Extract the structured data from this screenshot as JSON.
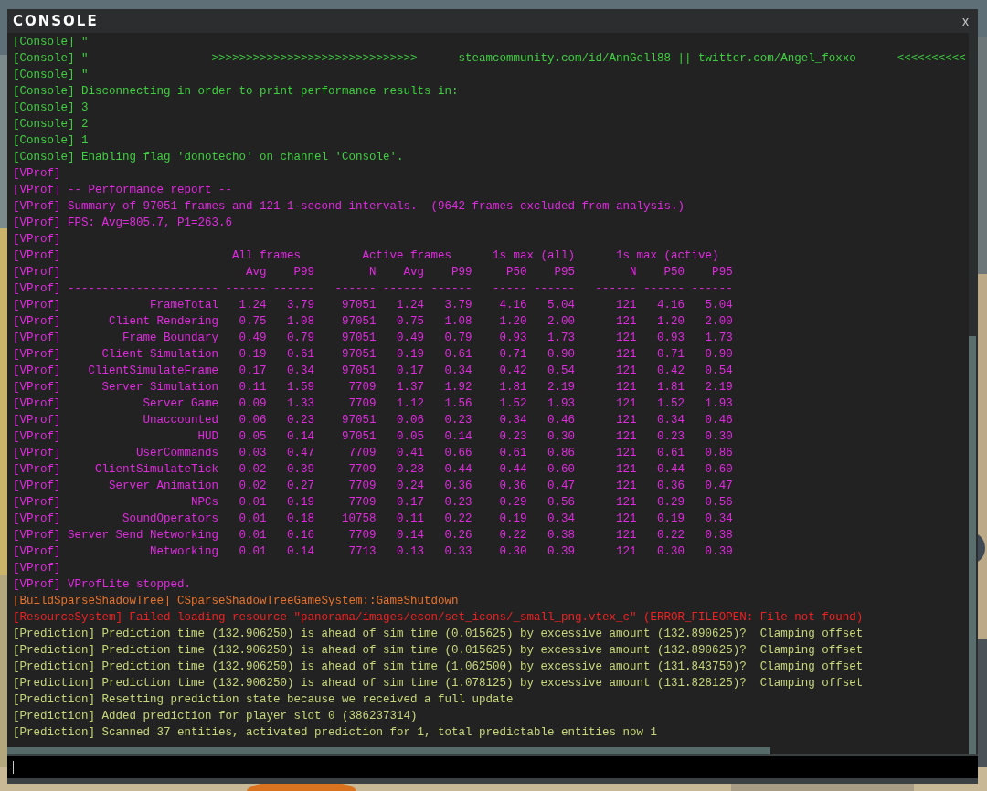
{
  "window": {
    "title": "CONSOLE",
    "close": "x"
  },
  "lines": [
    {
      "kind": "console",
      "text": "[Console] \""
    },
    {
      "kind": "console",
      "text": "[Console] \"                  >>>>>>>>>>>>>>>>>>>>>>>>>>>>>>      steamcommunity.com/id/AnnGell88 || twitter.com/Angel_foxxo      <<<<<<<<<<"
    },
    {
      "kind": "console",
      "text": "[Console] \""
    },
    {
      "kind": "console",
      "text": "[Console] Disconnecting in order to print performance results in:"
    },
    {
      "kind": "console",
      "text": "[Console] 3"
    },
    {
      "kind": "console",
      "text": "[Console] 2"
    },
    {
      "kind": "console",
      "text": "[Console] 1"
    },
    {
      "kind": "console",
      "text": "[Console] Enabling flag 'donotecho' on channel 'Console'."
    },
    {
      "kind": "vprof",
      "text": "[VProf]"
    },
    {
      "kind": "vprof",
      "text": "[VProf] -- Performance report --"
    },
    {
      "kind": "vprof",
      "text": "[VProf] Summary of 97051 frames and 121 1-second intervals.  (9642 frames excluded from analysis.)"
    },
    {
      "kind": "vprof",
      "text": "[VProf] FPS: Avg=805.7, P1=263.6"
    },
    {
      "kind": "vprof",
      "text": "[VProf]"
    },
    {
      "kind": "vprof",
      "text": "[VProf]                         All frames         Active frames      1s max (all)      1s max (active)"
    },
    {
      "kind": "vprof",
      "tag": "[VProf]",
      "values": [
        "Avg",
        "P99",
        "N",
        "Avg",
        "P99",
        "P50",
        "P95",
        "N",
        "P50",
        "P95"
      ]
    },
    {
      "kind": "vprof",
      "text": "[VProf] ---------------------- ------ ------   ------ ------ ------   ----- ------   ------ ------ ------"
    },
    {
      "kind": "vprof",
      "tag": "[VProf]",
      "label": "FrameTotal",
      "values": [
        "1.24",
        "3.79",
        "97051",
        "1.24",
        "3.79",
        "4.16",
        "5.04",
        "121",
        "4.16",
        "5.04"
      ]
    },
    {
      "kind": "vprof",
      "tag": "[VProf]",
      "label": "Client Rendering",
      "values": [
        "0.75",
        "1.08",
        "97051",
        "0.75",
        "1.08",
        "1.20",
        "2.00",
        "121",
        "1.20",
        "2.00"
      ]
    },
    {
      "kind": "vprof",
      "tag": "[VProf]",
      "label": "Frame Boundary",
      "values": [
        "0.49",
        "0.79",
        "97051",
        "0.49",
        "0.79",
        "0.93",
        "1.73",
        "121",
        "0.93",
        "1.73"
      ]
    },
    {
      "kind": "vprof",
      "tag": "[VProf]",
      "label": "Client Simulation",
      "values": [
        "0.19",
        "0.61",
        "97051",
        "0.19",
        "0.61",
        "0.71",
        "0.90",
        "121",
        "0.71",
        "0.90"
      ]
    },
    {
      "kind": "vprof",
      "tag": "[VProf]",
      "label": "ClientSimulateFrame",
      "values": [
        "0.17",
        "0.34",
        "97051",
        "0.17",
        "0.34",
        "0.42",
        "0.54",
        "121",
        "0.42",
        "0.54"
      ]
    },
    {
      "kind": "vprof",
      "tag": "[VProf]",
      "label": "Server Simulation",
      "values": [
        "0.11",
        "1.59",
        "7709",
        "1.37",
        "1.92",
        "1.81",
        "2.19",
        "121",
        "1.81",
        "2.19"
      ]
    },
    {
      "kind": "vprof",
      "tag": "[VProf]",
      "label": "Server Game",
      "values": [
        "0.09",
        "1.33",
        "7709",
        "1.12",
        "1.56",
        "1.52",
        "1.93",
        "121",
        "1.52",
        "1.93"
      ]
    },
    {
      "kind": "vprof",
      "tag": "[VProf]",
      "label": "Unaccounted",
      "values": [
        "0.06",
        "0.23",
        "97051",
        "0.06",
        "0.23",
        "0.34",
        "0.46",
        "121",
        "0.34",
        "0.46"
      ]
    },
    {
      "kind": "vprof",
      "tag": "[VProf]",
      "label": "HUD",
      "values": [
        "0.05",
        "0.14",
        "97051",
        "0.05",
        "0.14",
        "0.23",
        "0.30",
        "121",
        "0.23",
        "0.30"
      ]
    },
    {
      "kind": "vprof",
      "tag": "[VProf]",
      "label": "UserCommands",
      "values": [
        "0.03",
        "0.47",
        "7709",
        "0.41",
        "0.66",
        "0.61",
        "0.86",
        "121",
        "0.61",
        "0.86"
      ]
    },
    {
      "kind": "vprof",
      "tag": "[VProf]",
      "label": "ClientSimulateTick",
      "values": [
        "0.02",
        "0.39",
        "7709",
        "0.28",
        "0.44",
        "0.44",
        "0.60",
        "121",
        "0.44",
        "0.60"
      ]
    },
    {
      "kind": "vprof",
      "tag": "[VProf]",
      "label": "Server Animation",
      "values": [
        "0.02",
        "0.27",
        "7709",
        "0.24",
        "0.36",
        "0.36",
        "0.47",
        "121",
        "0.36",
        "0.47"
      ]
    },
    {
      "kind": "vprof",
      "tag": "[VProf]",
      "label": "NPCs",
      "values": [
        "0.01",
        "0.19",
        "7709",
        "0.17",
        "0.23",
        "0.29",
        "0.56",
        "121",
        "0.29",
        "0.56"
      ]
    },
    {
      "kind": "vprof",
      "tag": "[VProf]",
      "label": "SoundOperators",
      "values": [
        "0.01",
        "0.18",
        "10758",
        "0.11",
        "0.22",
        "0.19",
        "0.34",
        "121",
        "0.19",
        "0.34"
      ]
    },
    {
      "kind": "vprof",
      "tag": "[VProf]",
      "label": "Server Send Networking",
      "values": [
        "0.01",
        "0.16",
        "7709",
        "0.14",
        "0.26",
        "0.22",
        "0.38",
        "121",
        "0.22",
        "0.38"
      ]
    },
    {
      "kind": "vprof",
      "tag": "[VProf]",
      "label": "Networking",
      "values": [
        "0.01",
        "0.14",
        "7713",
        "0.13",
        "0.33",
        "0.30",
        "0.39",
        "121",
        "0.30",
        "0.39"
      ]
    },
    {
      "kind": "vprof",
      "text": "[VProf]"
    },
    {
      "kind": "vprof",
      "text": "[VProf] VProfLite stopped."
    },
    {
      "kind": "build",
      "text": "[BuildSparseShadowTree] CSparseShadowTreeGameSystem::GameShutdown"
    },
    {
      "kind": "resource",
      "text": "[ResourceSystem] Failed loading resource \"panorama/images/econ/set_icons/_small_png.vtex_c\" (ERROR_FILEOPEN: File not found)"
    },
    {
      "kind": "prediction",
      "text": "[Prediction] Prediction time (132.906250) is ahead of sim time (0.015625) by excessive amount (132.890625)?  Clamping offset"
    },
    {
      "kind": "prediction",
      "text": "[Prediction] Prediction time (132.906250) is ahead of sim time (0.015625) by excessive amount (132.890625)?  Clamping offset"
    },
    {
      "kind": "prediction",
      "text": "[Prediction] Prediction time (132.906250) is ahead of sim time (1.062500) by excessive amount (131.843750)?  Clamping offset"
    },
    {
      "kind": "prediction",
      "text": "[Prediction] Prediction time (132.906250) is ahead of sim time (1.078125) by excessive amount (131.828125)?  Clamping offset"
    },
    {
      "kind": "prediction",
      "text": "[Prediction] Resetting prediction state because we received a full update"
    },
    {
      "kind": "prediction",
      "text": "[Prediction] Added prediction for player slot 0 (386237314)"
    },
    {
      "kind": "prediction",
      "text": "[Prediction] Scanned 37 entities, activated prediction for 1, total predictable entities now 1"
    }
  ]
}
